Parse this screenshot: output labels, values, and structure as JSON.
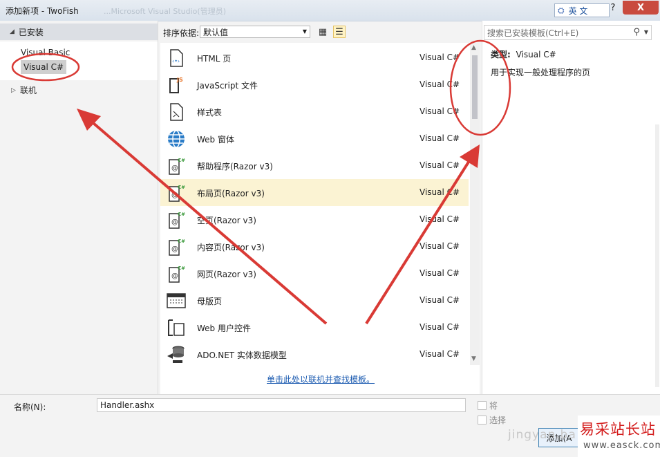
{
  "window": {
    "title": "添加新项 - TwoFish",
    "background_ghost_title": "...Microsoft Visual Studio(管理员)",
    "ime_label": "英 文",
    "help": "?",
    "close": "X"
  },
  "left_panel": {
    "installed_header": "已安装",
    "tree_items": [
      "Visual Basic",
      "Visual C#"
    ],
    "selected_item": "Visual C#",
    "online": "联机"
  },
  "toolbar": {
    "sort_label": "排序依据:",
    "sort_value": "默认值"
  },
  "templates": [
    {
      "name": "HTML 页",
      "lang": "Visual C#",
      "icon": "html-page-icon"
    },
    {
      "name": "JavaScript 文件",
      "lang": "Visual C#",
      "icon": "javascript-file-icon"
    },
    {
      "name": "样式表",
      "lang": "Visual C#",
      "icon": "stylesheet-icon"
    },
    {
      "name": "Web 窗体",
      "lang": "Visual C#",
      "icon": "web-form-globe-icon"
    },
    {
      "name": "帮助程序(Razor v3)",
      "lang": "Visual C#",
      "icon": "razor-file-icon"
    },
    {
      "name": "布局页(Razor v3)",
      "lang": "Visual C#",
      "icon": "razor-file-icon"
    },
    {
      "name": "空页(Razor v3)",
      "lang": "Visual C#",
      "icon": "razor-file-icon"
    },
    {
      "name": "内容页(Razor v3)",
      "lang": "Visual C#",
      "icon": "razor-file-icon"
    },
    {
      "name": "网页(Razor v3)",
      "lang": "Visual C#",
      "icon": "razor-file-icon"
    },
    {
      "name": "母版页",
      "lang": "Visual C#",
      "icon": "master-page-icon"
    },
    {
      "name": "Web 用户控件",
      "lang": "Visual C#",
      "icon": "user-control-icon"
    },
    {
      "name": "ADO.NET 实体数据模型",
      "lang": "Visual C#",
      "icon": "entity-model-icon"
    }
  ],
  "selected_template_index": 5,
  "online_link": "单击此处以联机并查找模板。",
  "right_panel": {
    "search_placeholder": "搜索已安装模板(Ctrl+E)",
    "type_label": "类型:",
    "type_value": "Visual C#",
    "description": "用于实现一般处理程序的页"
  },
  "bottom": {
    "name_label": "名称(N):",
    "name_value": "Handler.ashx",
    "check1": "将",
    "check2": "选择",
    "add_button": "添加(A"
  },
  "watermark": {
    "jingyan": "jingyan.ba",
    "site_cn": "易采站长站",
    "site_url": "www.easck.com"
  },
  "colors": {
    "annotation_red": "#d93a35",
    "selection_yellow": "#fbf3d3",
    "link_blue": "#1a5ab0",
    "close_red": "#c94b3f"
  }
}
